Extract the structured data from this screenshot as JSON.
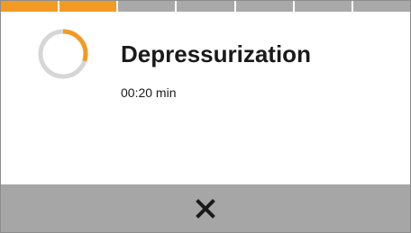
{
  "dialog": {
    "title": "Depressurization",
    "remaining_time": "00:20 min"
  },
  "step_indicator": {
    "total_steps": 7,
    "completed_steps": 2
  },
  "progress_ring": {
    "progress": 0.3,
    "track_color": "#d6d6d6",
    "fill_color": "#f39a24"
  },
  "footer": {
    "close_icon": "close-icon"
  },
  "colors": {
    "accent": "#f39a24",
    "inactive_step": "#a9a9a9",
    "footer_bg": "#a6a6a6",
    "text": "#1a1a1a"
  }
}
